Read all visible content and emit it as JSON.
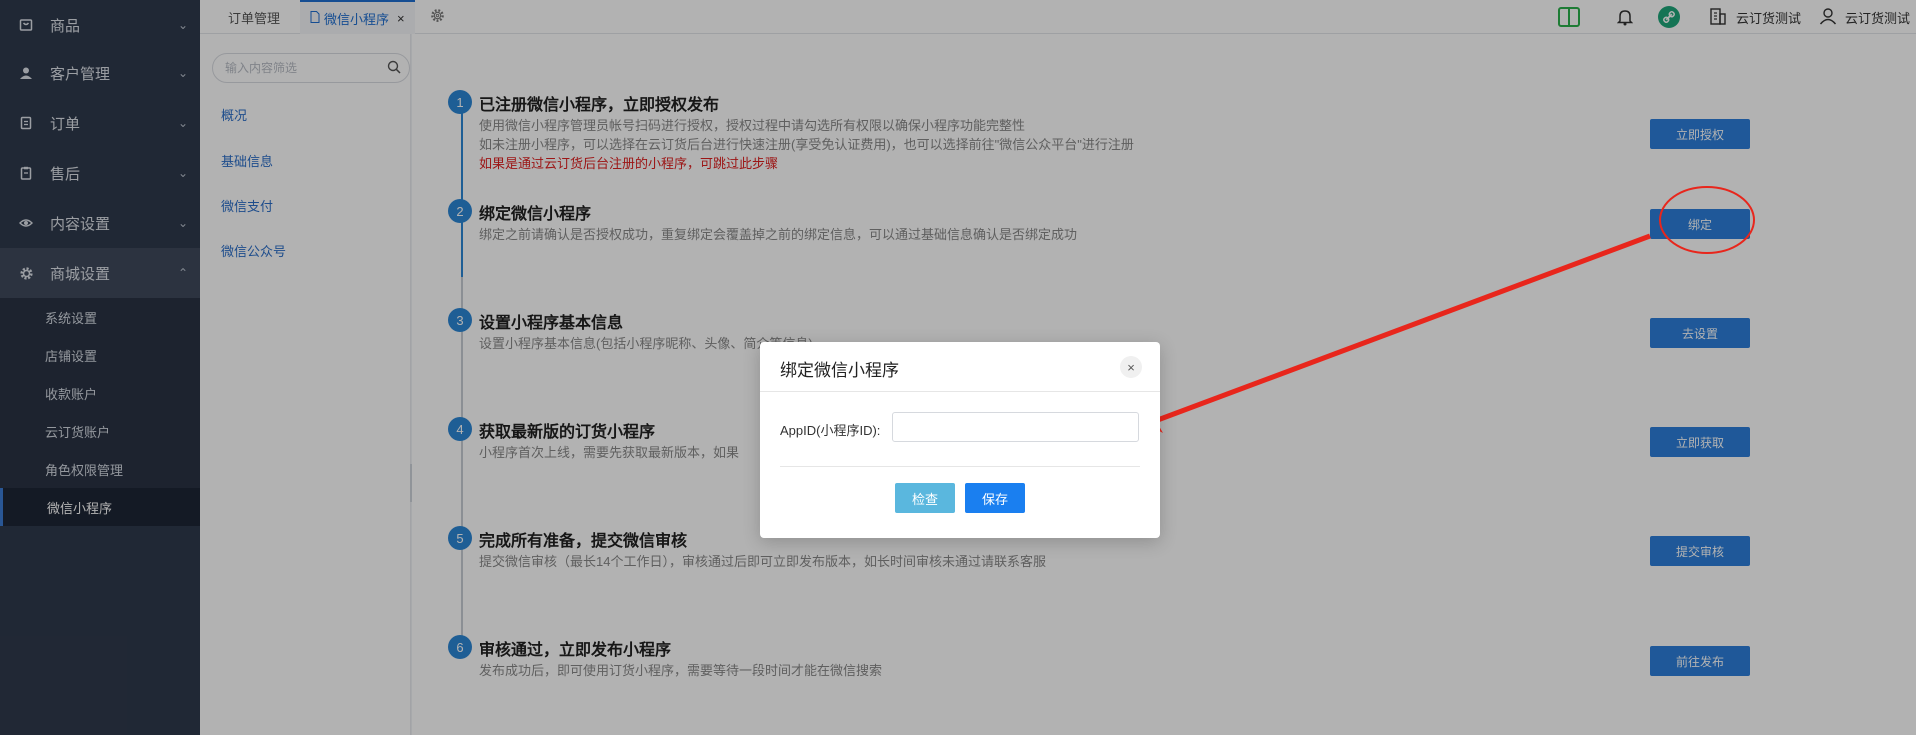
{
  "sidebar": {
    "items": [
      {
        "label": "商品",
        "icon": "bag-icon"
      },
      {
        "label": "客户管理",
        "icon": "user-icon"
      },
      {
        "label": "订单",
        "icon": "order-icon"
      },
      {
        "label": "售后",
        "icon": "clipboard-icon"
      },
      {
        "label": "内容设置",
        "icon": "eye-icon"
      },
      {
        "label": "商城设置",
        "icon": "gear-icon"
      }
    ],
    "submenu": [
      "系统设置",
      "店铺设置",
      "收款账户",
      "云订货账户",
      "角色权限管理",
      "微信小程序"
    ]
  },
  "tabs": {
    "order": "订单管理",
    "wechat": "微信小程序",
    "close": "×"
  },
  "topbar": {
    "store": "云订货测试",
    "user": "云订货测试",
    "accent_green": "#2bb24c",
    "accent_teal": "#1fa67a"
  },
  "subnav": {
    "search_placeholder": "输入内容筛选",
    "links": [
      "概况",
      "基础信息",
      "微信支付",
      "微信公众号"
    ]
  },
  "steps": [
    {
      "num": "1",
      "title": "已注册微信小程序，立即授权发布",
      "desc": [
        "使用微信小程序管理员帐号扫码进行授权，授权过程中请勾选所有权限以确保小程序功能完整性",
        "如未注册小程序，可以选择在云订货后台进行快速注册(享受免认证费用)，也可以选择前往\"微信公众平台\"进行注册"
      ],
      "note": "如果是通过云订货后台注册的小程序，可跳过此步骤",
      "button": "立即授权"
    },
    {
      "num": "2",
      "title": "绑定微信小程序",
      "desc": [
        "绑定之前请确认是否授权成功，重复绑定会覆盖掉之前的绑定信息，可以通过基础信息确认是否绑定成功"
      ],
      "button": "绑定"
    },
    {
      "num": "3",
      "title": "设置小程序基本信息",
      "desc": [
        "设置小程序基本信息(包括小程序昵称、头像、简介等信息)"
      ],
      "button": "去设置"
    },
    {
      "num": "4",
      "title": "获取最新版的订货小程序",
      "desc": [
        "小程序首次上线，需要先获取最新版本，如果"
      ],
      "button": "立即获取"
    },
    {
      "num": "5",
      "title": "完成所有准备，提交微信审核",
      "desc": [
        "提交微信审核（最长14个工作日），审核通过后即可立即发布版本，如长时间审核未通过请联系客服"
      ],
      "button": "提交审核"
    },
    {
      "num": "6",
      "title": "审核通过，立即发布小程序",
      "desc": [
        "发布成功后，即可使用订货小程序，需要等待一段时间才能在微信搜索"
      ],
      "button": "前往发布"
    }
  ],
  "modal": {
    "title": "绑定微信小程序",
    "close": "×",
    "label": "AppID(小程序ID):",
    "input_value": "",
    "check": "检查",
    "save": "保存"
  }
}
